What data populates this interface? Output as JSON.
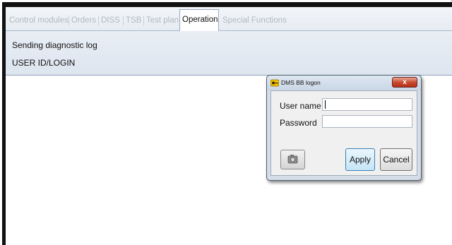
{
  "tabs": [
    {
      "label": "Control modules",
      "active": false
    },
    {
      "label": "Orders",
      "active": false
    },
    {
      "label": "DISS",
      "active": false
    },
    {
      "label": "TSB",
      "active": false
    },
    {
      "label": "Test plan",
      "active": false
    },
    {
      "label": "Operation",
      "active": true
    },
    {
      "label": "Special Functions",
      "active": false
    }
  ],
  "info": {
    "line1": "Sending diagnostic log",
    "line2": "USER ID/LOGIN"
  },
  "dialog": {
    "title": "DMS BB logon",
    "close_label": "x",
    "username_label": "User name",
    "username_value": "",
    "password_label": "Password",
    "password_value": "",
    "apply_label": "Apply",
    "cancel_label": "Cancel",
    "icons": {
      "title": "key-icon",
      "camera": "camera-icon",
      "close": "close-icon"
    }
  },
  "colors": {
    "accent_border": "#3c7fb1",
    "close_button": "#c9452c",
    "panel_bg": "#dde5ef"
  }
}
